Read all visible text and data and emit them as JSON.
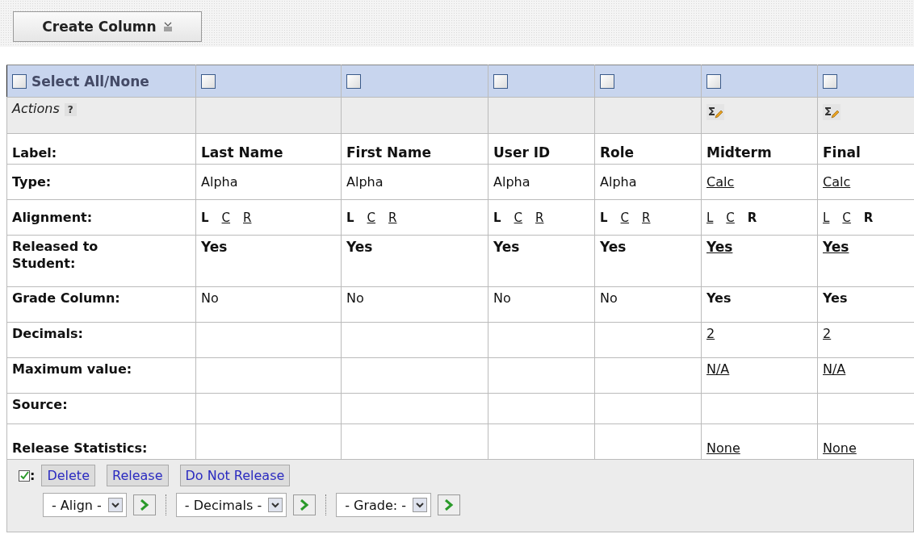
{
  "toolbar": {
    "create_button": "Create Column"
  },
  "select_all": {
    "label": "Select All/None",
    "checked": false
  },
  "row_labels": {
    "actions": "Actions",
    "help": "?",
    "label": "Label:",
    "type": "Type:",
    "alignment": "Alignment:",
    "released": "Released to Student:",
    "grade": "Grade Column:",
    "decimals": "Decimals:",
    "maximum": "Maximum value:",
    "source": "Source:",
    "statistics": "Release Statistics:"
  },
  "columns": [
    {
      "kind": "alpha",
      "checked": false,
      "label": "Last Name",
      "type": {
        "text": "Alpha",
        "link": false
      },
      "alignment": [
        {
          "label": "L",
          "selected": true
        },
        {
          "label": "C",
          "selected": false
        },
        {
          "label": "R",
          "selected": false
        }
      ],
      "released": {
        "text": "Yes",
        "link": false
      },
      "grade": {
        "text": "No",
        "bold": false
      }
    },
    {
      "kind": "alpha",
      "checked": false,
      "label": "First Name",
      "type": {
        "text": "Alpha",
        "link": false
      },
      "alignment": [
        {
          "label": "L",
          "selected": true
        },
        {
          "label": "C",
          "selected": false
        },
        {
          "label": "R",
          "selected": false
        }
      ],
      "released": {
        "text": "Yes",
        "link": false
      },
      "grade": {
        "text": "No",
        "bold": false
      }
    },
    {
      "kind": "alpha",
      "checked": false,
      "label": "User ID",
      "type": {
        "text": "Alpha",
        "link": false
      },
      "alignment": [
        {
          "label": "L",
          "selected": true
        },
        {
          "label": "C",
          "selected": false
        },
        {
          "label": "R",
          "selected": false
        }
      ],
      "released": {
        "text": "Yes",
        "link": false
      },
      "grade": {
        "text": "No",
        "bold": false
      }
    },
    {
      "kind": "alpha",
      "checked": false,
      "label": "Role",
      "type": {
        "text": "Alpha",
        "link": false
      },
      "alignment": [
        {
          "label": "L",
          "selected": true
        },
        {
          "label": "C",
          "selected": false
        },
        {
          "label": "R",
          "selected": false
        }
      ],
      "released": {
        "text": "Yes",
        "link": false
      },
      "grade": {
        "text": "No",
        "bold": false
      }
    },
    {
      "kind": "calc",
      "checked": false,
      "label": "Midterm",
      "type": {
        "text": "Calc",
        "link": true
      },
      "alignment": [
        {
          "label": "L",
          "selected": false
        },
        {
          "label": "C",
          "selected": false
        },
        {
          "label": "R",
          "selected": true
        }
      ],
      "released": {
        "text": "Yes",
        "link": true
      },
      "grade": {
        "text": "Yes",
        "bold": true
      },
      "decimals": "2",
      "maximum": "N/A",
      "statistics": "None"
    },
    {
      "kind": "calc",
      "checked": false,
      "label": "Final",
      "type": {
        "text": "Calc",
        "link": true
      },
      "alignment": [
        {
          "label": "L",
          "selected": false
        },
        {
          "label": "C",
          "selected": false
        },
        {
          "label": "R",
          "selected": true
        }
      ],
      "released": {
        "text": "Yes",
        "link": true
      },
      "grade": {
        "text": "Yes",
        "bold": true
      },
      "decimals": "2",
      "maximum": "N/A",
      "statistics": "None"
    }
  ],
  "footer": {
    "colon": ":",
    "buttons": [
      "Delete",
      "Release",
      "Do Not Release"
    ],
    "selects": [
      "- Align -",
      "- Decimals -",
      "- Grade: -"
    ]
  }
}
